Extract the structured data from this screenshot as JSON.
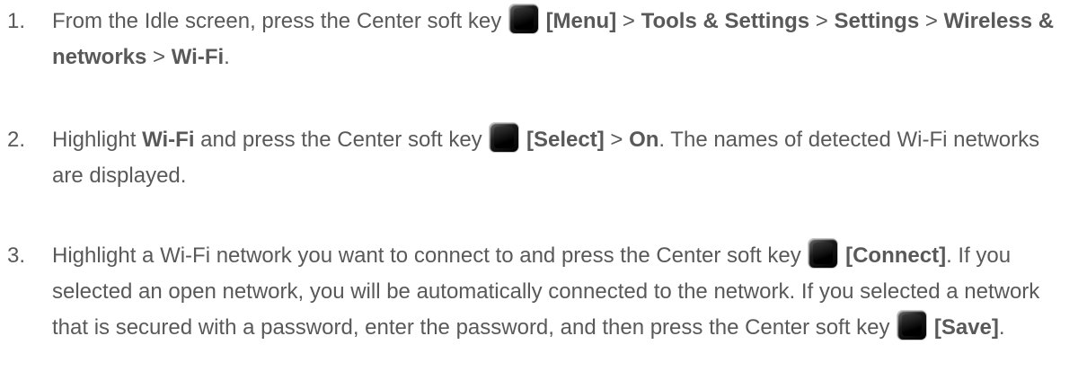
{
  "steps": [
    {
      "number": "1.",
      "text1": "From the Idle screen, press the Center soft key",
      "b1": "[Menu]",
      "sep1": " > ",
      "b2": "Tools & Settings",
      "sep2": " > ",
      "b3": "Settings",
      "sep3": " > ",
      "b4": "Wireless & networks",
      "sep4": " > ",
      "b5": "Wi-Fi",
      "end": "."
    },
    {
      "number": "2.",
      "text1": "Highlight ",
      "b1": "Wi-Fi",
      "text2": " and press the Center soft key",
      "b2": "[Select]",
      "sep1": " > ",
      "b3": "On",
      "text3": ". The names of detected Wi-Fi networks are displayed."
    },
    {
      "number": "3.",
      "text1": "Highlight a Wi-Fi network you want to connect to and press the Center soft key",
      "b1": "[Connect]",
      "text2": ". If you selected an open network, you will be automatically connected to the network. If you selected a network that is secured with a password, enter the password, and then press the Center soft key",
      "b2": "[Save]",
      "end": "."
    }
  ],
  "icons": {
    "center_soft_key": "center-soft-key-icon"
  }
}
